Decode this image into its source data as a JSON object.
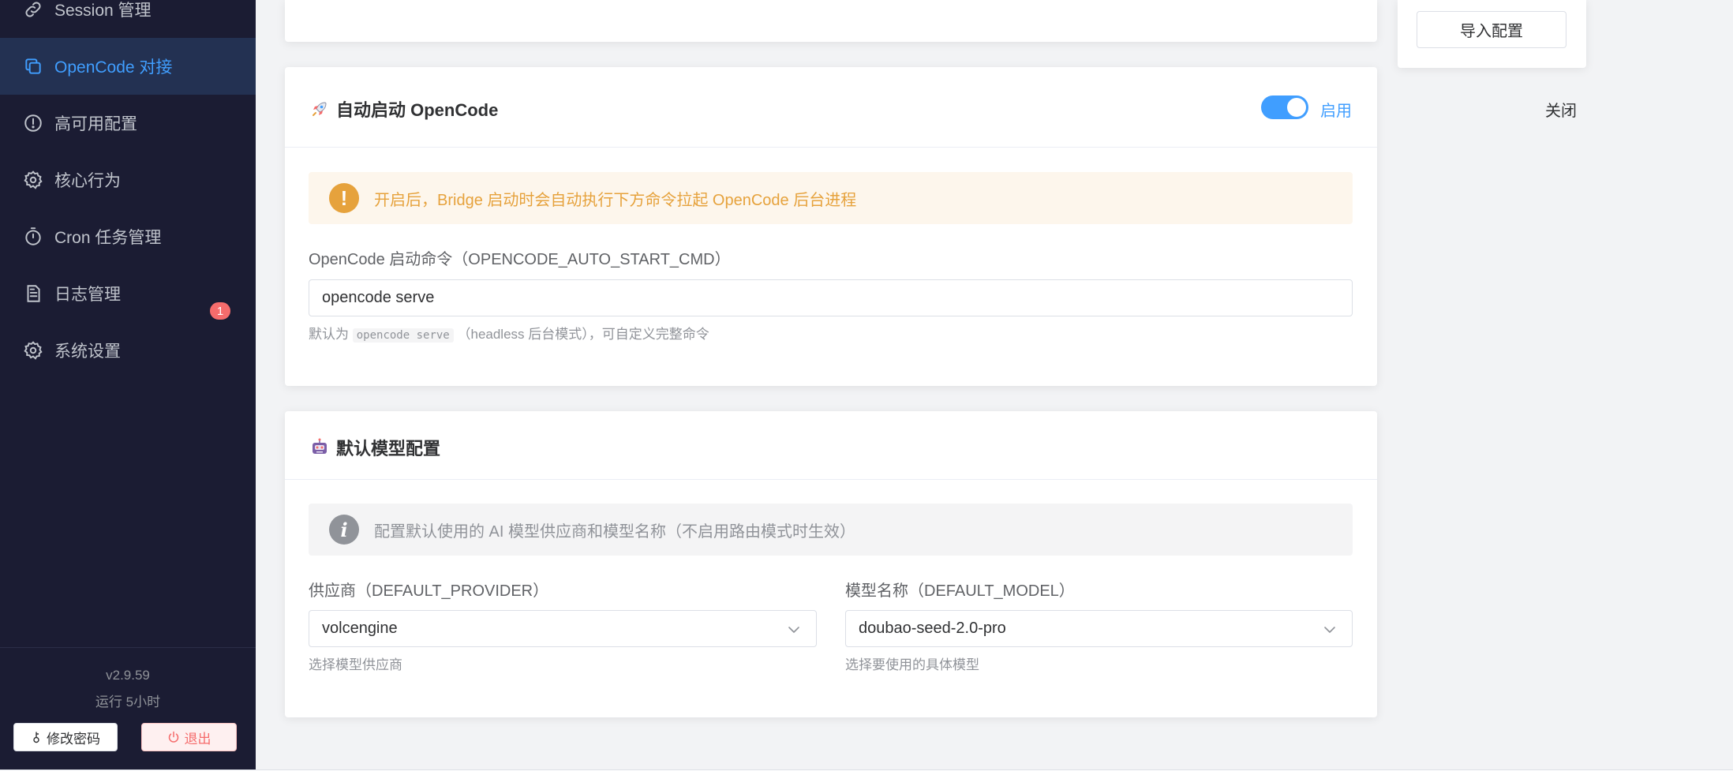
{
  "sidebar": {
    "items": [
      {
        "label": "Session 管理",
        "icon": "link-icon"
      },
      {
        "label": "OpenCode 对接",
        "icon": "copy-icon"
      },
      {
        "label": "高可用配置",
        "icon": "warning-circle-icon"
      },
      {
        "label": "核心行为",
        "icon": "gear-icon"
      },
      {
        "label": "Cron 任务管理",
        "icon": "stopwatch-icon"
      },
      {
        "label": "日志管理",
        "icon": "document-icon"
      },
      {
        "label": "系统设置",
        "icon": "gear-icon"
      }
    ],
    "badge": "1",
    "version": "v2.9.59",
    "uptime": "运行 5小时",
    "change_password": "修改密码",
    "logout": "退出"
  },
  "side_panel": {
    "import_button": "导入配置"
  },
  "auto_start": {
    "title": "自动启动 OpenCode",
    "switch_off_label": "关闭",
    "switch_on_label": "启用",
    "enabled": true,
    "alert": "开启后，Bridge 启动时会自动执行下方命令拉起 OpenCode 后台进程",
    "command_label": "OpenCode 启动命令（OPENCODE_AUTO_START_CMD）",
    "command_value": "opencode serve",
    "hint_prefix": "默认为",
    "hint_code": "opencode serve",
    "hint_suffix": "（headless 后台模式），可自定义完整命令"
  },
  "default_model": {
    "title": "默认模型配置",
    "alert": "配置默认使用的 AI 模型供应商和模型名称（不启用路由模式时生效）",
    "provider_label": "供应商（DEFAULT_PROVIDER）",
    "provider_value": "volcengine",
    "provider_hint": "选择模型供应商",
    "model_label": "模型名称（DEFAULT_MODEL）",
    "model_value": "doubao-seed-2.0-pro",
    "model_hint": "选择要使用的具体模型"
  },
  "colors": {
    "sidebar_bg": "#1b1c33",
    "accent": "#409eff",
    "warning": "#e6a23c",
    "danger": "#f56c6c"
  }
}
